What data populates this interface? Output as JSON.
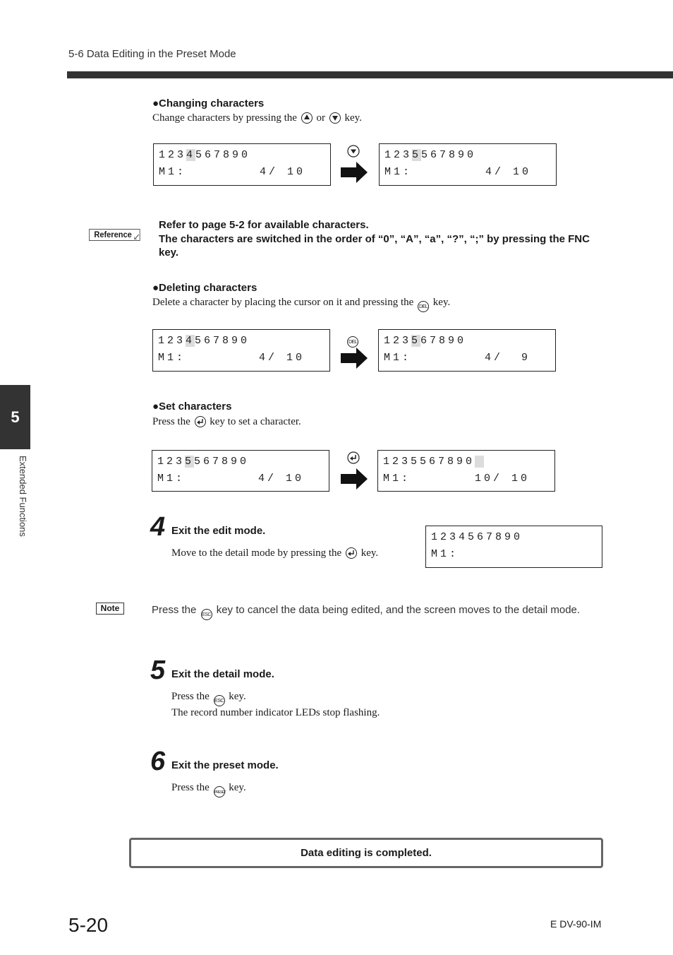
{
  "header": {
    "running_title": "5-6  Data Editing in the Preset Mode"
  },
  "sidebar": {
    "chapter_number": "5",
    "chapter_label": "Extended Functions"
  },
  "sections": {
    "changing": {
      "title": "●Changing characters",
      "text_before": "Change characters by pressing the",
      "text_mid": "or",
      "text_after": "key.",
      "key_1": "up-key",
      "key_2": "down-key",
      "operation_key": "down-key",
      "before": {
        "line1_pre": "123",
        "line1_cursor": "4",
        "line1_post": "567890",
        "line2": "M1:        4/ 10"
      },
      "after": {
        "line1_pre": "123",
        "line1_cursor": "5",
        "line1_post": "567890",
        "line2": "M1:        4/ 10"
      }
    },
    "reference": {
      "tag": "Reference",
      "line1": "Refer to page 5-2 for available characters.",
      "line2": "The characters are switched in the order of “0”, “A”, “a”, “?”, “;” by pressing the FNC key."
    },
    "deleting": {
      "title": "●Deleting characters",
      "text_before": "Delete a character by placing the cursor on it and pressing the",
      "text_after": "key.",
      "key_label": "DEL",
      "before": {
        "line1_pre": "123",
        "line1_cursor": "4",
        "line1_post": "567890",
        "line2": "M1:        4/ 10"
      },
      "after": {
        "line1_pre": "123",
        "line1_cursor": "5",
        "line1_post": "67890",
        "line2": "M1:        4/  9"
      }
    },
    "setting": {
      "title": "●Set characters",
      "text_before": "Press the",
      "text_after": "key to set a character.",
      "key_name": "enter-key",
      "before": {
        "line1_pre": "123",
        "line1_cursor": "5",
        "line1_post": "567890",
        "line2": "M1:        4/ 10"
      },
      "after": {
        "line1_pre": "1235567890",
        "line1_cursor": " ",
        "line1_post": "",
        "line2": "M1:       10/ 10"
      }
    }
  },
  "steps": [
    {
      "number": "4",
      "title": "Exit the edit mode.",
      "text_before": "Move to the detail mode by pressing the",
      "text_after": "key.",
      "lcd": {
        "line1": "1234567890",
        "line2": "M1:"
      }
    },
    {
      "number": "5",
      "title": "Exit the detail mode.",
      "text_before": "Press the",
      "text_after": "key.",
      "key_label": "ESC",
      "line2": "The record number indicator LEDs stop flashing."
    },
    {
      "number": "6",
      "title": "Exit the preset mode.",
      "text_before": "Press the",
      "text_after": "key.",
      "key_label": "PRESET"
    }
  ],
  "note": {
    "tag": "Note",
    "text_before": "Press the",
    "key_label": "ESC",
    "text_after": "key to cancel the data being edited, and the screen moves to the detail mode."
  },
  "completion": {
    "text": "Data editing is completed."
  },
  "footer": {
    "page_number": "5-20",
    "doc_code": "E DV-90-IM"
  }
}
